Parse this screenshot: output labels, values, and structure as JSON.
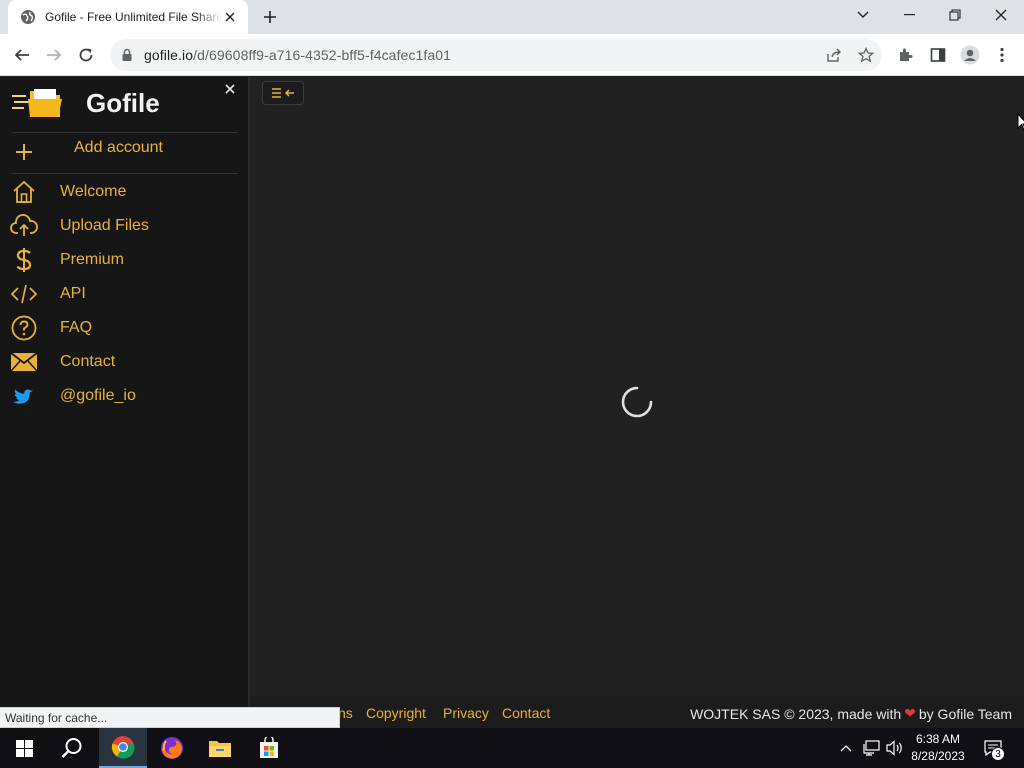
{
  "browser": {
    "tab_title": "Gofile - Free Unlimited File Sharing and Storage",
    "url_host": "gofile.io",
    "url_path": "/d/69608ff9-a716-4352-bff5-f4cafec1fa01",
    "status_text": "Waiting for cache..."
  },
  "sidebar": {
    "brand": "Gofile",
    "add_account": "Add account",
    "items": [
      {
        "label": "Welcome",
        "icon": "home-icon"
      },
      {
        "label": "Upload Files",
        "icon": "cloud-upload-icon"
      },
      {
        "label": "Premium",
        "icon": "dollar-icon"
      },
      {
        "label": "API",
        "icon": "code-icon"
      },
      {
        "label": "FAQ",
        "icon": "question-icon"
      },
      {
        "label": "Contact",
        "icon": "envelope-icon"
      },
      {
        "label": "@gofile_io",
        "icon": "twitter-icon"
      }
    ]
  },
  "footer": {
    "links": [
      "ns",
      "Copyright",
      "Privacy",
      "Contact"
    ],
    "copyright_pre": "WOJTEK SAS © 2023, made with",
    "copyright_post": "by Gofile Team"
  },
  "taskbar": {
    "time": "6:38 AM",
    "date": "8/28/2023",
    "notification_count": "3"
  },
  "colors": {
    "accent": "#e8b23a",
    "sidebar_bg": "#161616",
    "page_bg": "#212121",
    "twitter": "#1d9bf0"
  }
}
